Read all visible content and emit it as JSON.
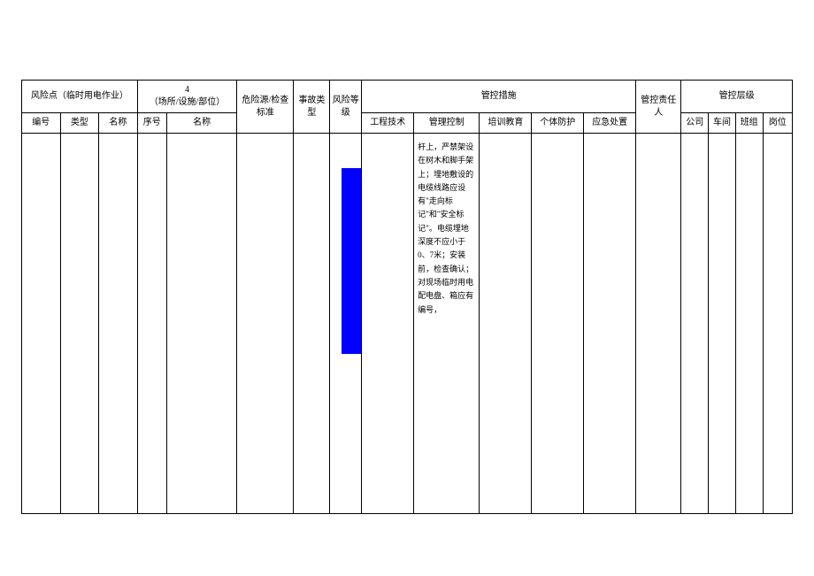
{
  "header": {
    "risk_point_label": "风险点（临时用电作业）",
    "location_code": "4",
    "location_label": "（场所/设施/部位）",
    "hazard_std_label": "危险源/检查标准",
    "accident_type_label": "事故类型",
    "risk_level_label": "风险等级",
    "control_measures_label": "管控措施",
    "responsible_label": "管控责任人",
    "control_level_label": "管控层级"
  },
  "sub_header": {
    "no_label": "编号",
    "type_label": "类型",
    "name_label": "名称",
    "seq_label": "序号",
    "name2_label": "名称",
    "eng_tech_label": "工程技术",
    "mgmt_ctrl_label": "管理控制",
    "training_label": "培训教育",
    "ppe_label": "个体防护",
    "emergency_label": "应急处置",
    "company_label": "公司",
    "workshop_label": "车间",
    "team_label": "班组",
    "position_label": "岗位"
  },
  "row": {
    "no": "",
    "type": "",
    "name": "",
    "seq": "",
    "name2": "",
    "hazard": "",
    "accident": "",
    "risk_level": "",
    "eng_tech": "",
    "mgmt_ctrl": "杆上，严禁架设在树木和脚手架上；埋地敷设的电缆线路应设有\"走向标记\"和\"安全标记\"。电缆埋地深度不应小于0、7米；安装前，检查确认；对现场临时用电配电盘、箱应有编号，",
    "training": "",
    "ppe": "",
    "emergency": "",
    "responsible": "",
    "company": "",
    "workshop": "",
    "team": "",
    "position": ""
  }
}
